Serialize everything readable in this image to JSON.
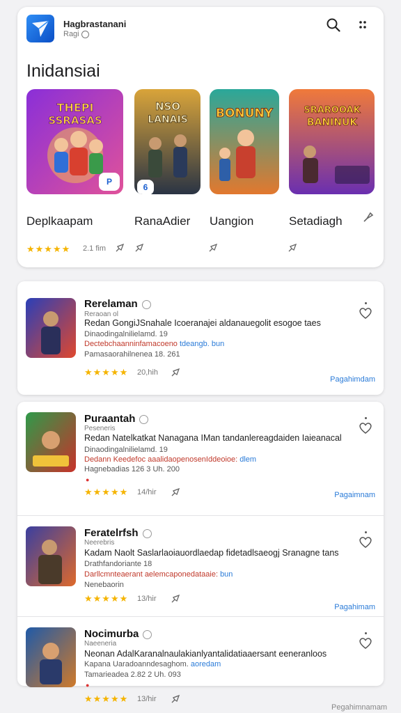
{
  "header": {
    "app_name": "Hagbrastanani",
    "app_sub": "Ragi",
    "title": "Inidansiai"
  },
  "featured": [
    {
      "title": "Deplkaapam",
      "art_text": "THEPI SSRASAS",
      "badge": "P",
      "rating_stars": "★★★★★",
      "rating": 4,
      "meta": "2.1 fim",
      "colors": [
        "#7a2fd0",
        "#d94fa3"
      ]
    },
    {
      "title": "RanaAdier",
      "art_text": "NSO LANAIS",
      "badge": "6",
      "rating_stars": "",
      "rating": null,
      "meta": "",
      "colors": [
        "#2f3a4a",
        "#c9882d"
      ]
    },
    {
      "title": "Uangion",
      "art_text": "BONUNY",
      "badge": "",
      "rating_stars": "",
      "rating": null,
      "meta": "",
      "colors": [
        "#1f9b8a",
        "#e07a2e"
      ]
    },
    {
      "title": "Setadiagh",
      "art_text": "SRAROOAK BANINUK",
      "badge": "",
      "rating_stars": "",
      "rating": null,
      "meta": "",
      "colors": [
        "#e85a3a",
        "#6a2fb0"
      ]
    }
  ],
  "list": [
    {
      "title": "Rerelaman",
      "sub": "Reraoan ol",
      "desc": "Redan GongiJSnahale Icoeranajei aldanauegolit esogoe taes",
      "line1": "Dinaodingalnilielamd.  19",
      "line2_red": "Dectebchaanninfamacoeno ",
      "line2_blue": "tdeangb. bun",
      "line3": "Pamasaorahilnenea 18.  261",
      "stars": "★★★★★",
      "meta": "20,hih",
      "link": "Pagahimdam",
      "colors": [
        "#2a3fb8",
        "#e0482e"
      ]
    },
    {
      "title": "Puraantah",
      "sub": "Peseneris",
      "desc": "Redan Natelkatkat Nanagana IMan tandanlereagdaiden Iaieanacal",
      "line1": "Dinaodingalnilielamd.  19",
      "line2_red": "Dedann Keedefoc aaalidaopenosenIddeoioe: ",
      "line2_blue": "dlem",
      "line3": "Hagnebadias 126 3 Uh.  200",
      "stars": "★★★★★",
      "meta": "14/hir",
      "link": "Pagaimnam",
      "colors": [
        "#2f9a4a",
        "#c9312a"
      ]
    },
    {
      "title": "Feratelrfsh",
      "sub": "Neerebris",
      "desc": "Kadam Naolt Saslarlaoiauordlaedap fidetadlsaeogj Sranagne tans",
      "line1": "Drathfandoriante 18",
      "line2_red": "Darllcmnteaerant aelemcaponedataaie: ",
      "line2_blue": "bun",
      "line3": "Nenebaorin",
      "stars": "★★★★★",
      "meta": "13/hir",
      "link": "Pagahimam",
      "colors": [
        "#3a3fa0",
        "#e06a2a"
      ]
    },
    {
      "title": "Nocimurba",
      "sub": "Naeeneria",
      "desc": "Neonan AdalKaranalnaulakianlyantalidatiaaersant eeneranloos",
      "line1": "Kapana Uaradoanndesaghom.  ",
      "line1_blue": "aoredam",
      "line2_red": "",
      "line2_blue": "",
      "line3": "Tamarieadea 2.82 2 Uh.  093",
      "stars": "★★★★★",
      "meta": "13/hir",
      "link": "",
      "colors": [
        "#1f5aa8",
        "#d07a2a"
      ]
    }
  ],
  "footer_link": "Pegahimnamam",
  "colors": {
    "accent": "#2a7bd8",
    "star": "#f5b400",
    "brand": "#1a5fd0"
  }
}
